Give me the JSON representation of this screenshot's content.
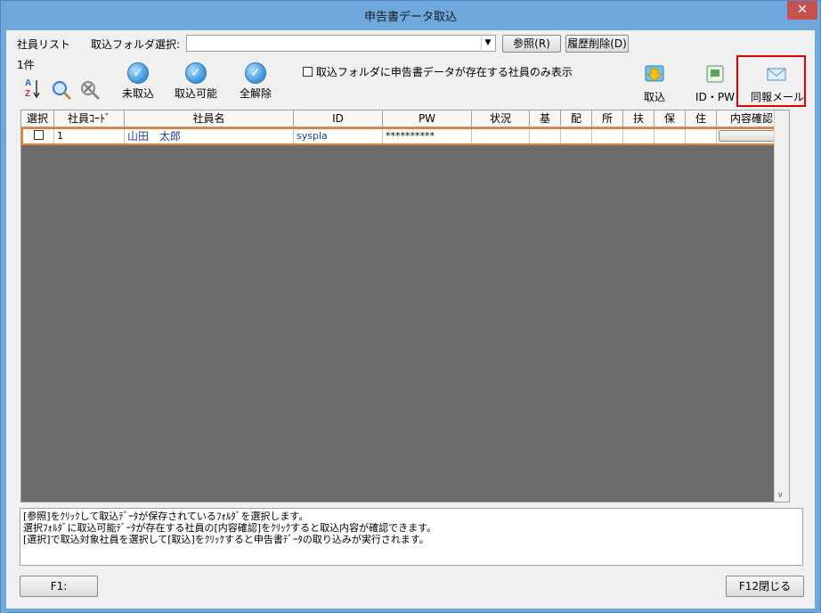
{
  "window": {
    "title": "申告書データ取込",
    "close_glyph": "✕"
  },
  "toolbar": {
    "employee_list_label": "社員リスト",
    "folder_select_label": "取込フォルダ選択:",
    "folder_value": "",
    "browse_button": "参照(R)",
    "clear_history_button": "履歴削除(D)",
    "count": "1件",
    "not_imported_label": "未取込",
    "importable_label": "取込可能",
    "clear_all_label": "全解除",
    "filter_checkbox_label": "取込フォルダに申告書データが存在する社員のみ表示",
    "import_label": "取込",
    "id_pw_label": "ID・PW",
    "notify_mail_label": "同報メール"
  },
  "grid": {
    "headers": [
      "選択",
      "社員ｺｰﾄﾞ",
      "社員名",
      "ID",
      "PW",
      "状況",
      "基",
      "配",
      "所",
      "扶",
      "保",
      "住",
      "内容確認"
    ],
    "rows": [
      {
        "code": "1",
        "name": "山田　太郎",
        "id": "syspla",
        "pw": "**********",
        "status": "",
        "confirm_button": ""
      }
    ]
  },
  "messages": [
    "[参照]をｸﾘｯｸして取込ﾃﾞｰﾀが保存されているﾌｫﾙﾀﾞを選択します。",
    "選択ﾌｫﾙﾀﾞに取込可能ﾃﾞｰﾀが存在する社員の[内容確認]をｸﾘｯｸすると取込内容が確認できます。",
    "[選択]で取込対象社員を選択して[取込]をｸﾘｯｸすると申告書ﾃﾞｰﾀの取り込みが実行されます。"
  ],
  "footer": {
    "f1_button": "F1:",
    "close_button": "F12閉じる"
  },
  "colors": {
    "title_bar": "#6fa8dc",
    "selected_row_border": "#f07c2a",
    "highlight": "#e30000"
  }
}
